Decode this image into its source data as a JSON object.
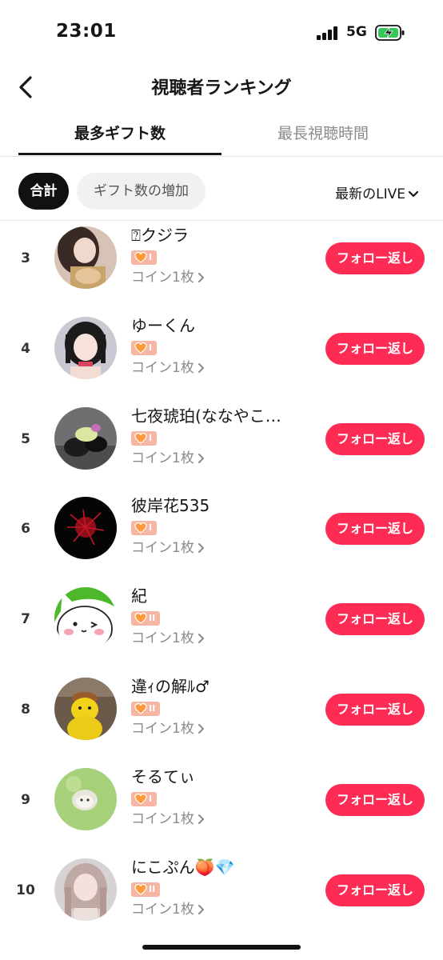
{
  "status": {
    "time": "23:01",
    "network": "5G"
  },
  "nav": {
    "title": "視聴者ランキング"
  },
  "tabs": [
    {
      "label": "最多ギフト数",
      "active": true
    },
    {
      "label": "最長視聴時間",
      "active": false
    }
  ],
  "filters": {
    "chips": [
      {
        "label": "合計",
        "active": true
      },
      {
        "label": "ギフト数の増加",
        "active": false
      }
    ],
    "live_select": "最新のLIVE"
  },
  "colors": {
    "accent": "#fe2c55",
    "badge": "#f7b5a3"
  },
  "viewers": [
    {
      "rank": "3",
      "name": "⍰クジラ",
      "level": "I",
      "coins": "コイン1枚",
      "button": "フォロー返し",
      "avatar": "avatar-girl-1"
    },
    {
      "rank": "4",
      "name": "ゆーくん",
      "level": "I",
      "coins": "コイン1枚",
      "button": "フォロー返し",
      "avatar": "avatar-girl-2"
    },
    {
      "rank": "5",
      "name": "七夜琥珀(ななやこ…",
      "level": "I",
      "coins": "コイン1枚",
      "button": "フォロー返し",
      "avatar": "avatar-motorbike"
    },
    {
      "rank": "6",
      "name": "彼岸花535",
      "level": "I",
      "coins": "コイン1枚",
      "button": "フォロー返し",
      "avatar": "avatar-red-flower"
    },
    {
      "rank": "7",
      "name": "紀",
      "level": "II",
      "coins": "コイン1枚",
      "button": "フォロー返し",
      "avatar": "avatar-cat"
    },
    {
      "rank": "8",
      "name": "違ｨの解ﾙ♂",
      "level": "II",
      "coins": "コイン1枚",
      "button": "フォロー返し",
      "avatar": "avatar-yellow-toy"
    },
    {
      "rank": "9",
      "name": "そるてぃ",
      "level": "I",
      "coins": "コイン1枚",
      "button": "フォロー返し",
      "avatar": "avatar-hedgehog"
    },
    {
      "rank": "10",
      "name": "にこぷん🍑💎",
      "level": "II",
      "coins": "コイン1枚",
      "button": "フォロー返し",
      "avatar": "avatar-girl-3"
    }
  ]
}
